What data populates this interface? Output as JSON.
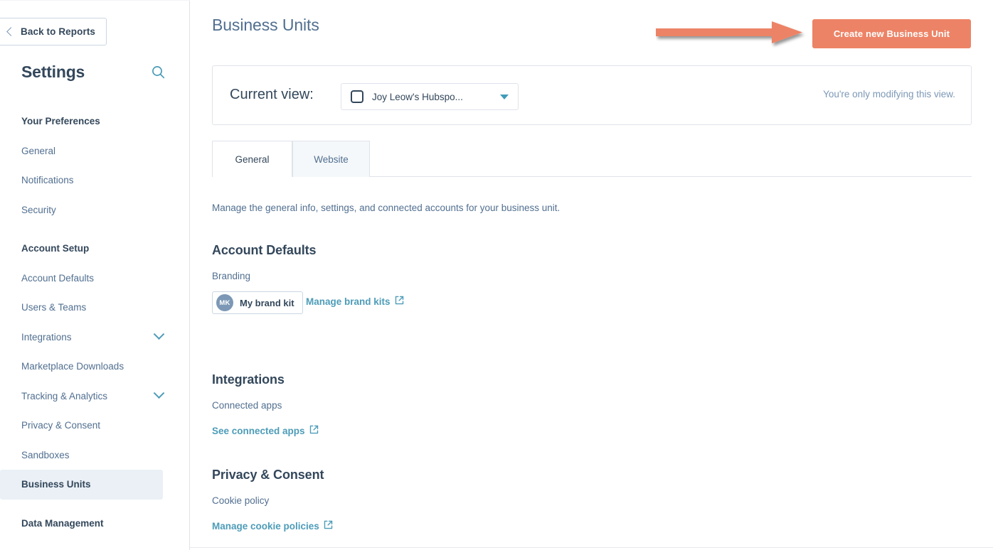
{
  "sidebar": {
    "back_button": {
      "label": "Back to Reports",
      "icon": "chevron-left-icon"
    },
    "title": "Settings",
    "search_icon": "search-icon",
    "items": [
      {
        "label": "Your Preferences",
        "type": "group"
      },
      {
        "label": "General",
        "type": "link"
      },
      {
        "label": "Notifications",
        "type": "link"
      },
      {
        "label": "Security",
        "type": "link"
      },
      {
        "label": "Account Setup",
        "type": "group"
      },
      {
        "label": "Account Defaults",
        "type": "link"
      },
      {
        "label": "Users & Teams",
        "type": "link"
      },
      {
        "label": "Integrations",
        "type": "link",
        "caret": "chevron-down-icon"
      },
      {
        "label": "Marketplace Downloads",
        "type": "link"
      },
      {
        "label": "Tracking & Analytics",
        "type": "link",
        "caret": "chevron-down-icon"
      },
      {
        "label": "Privacy & Consent",
        "type": "link"
      },
      {
        "label": "Sandboxes",
        "type": "link"
      },
      {
        "label": "Business Units",
        "type": "link",
        "active": true
      },
      {
        "label": "Data Management",
        "type": "group"
      }
    ]
  },
  "header": {
    "title": "Business Units",
    "create_button": "Create new Business Unit",
    "annotation_arrow": "arrow-right-annotation"
  },
  "current_view": {
    "label": "Current view:",
    "selected": "Joy Leow's Hubspo...",
    "unit_icon": "business-unit-square-icon",
    "caret_icon": "chevron-down-icon",
    "note": "You're only modifying this view."
  },
  "tabs": [
    {
      "label": "General",
      "active": true
    },
    {
      "label": "Website",
      "active": false
    }
  ],
  "intro": "Manage the general info, settings, and connected accounts for your business unit.",
  "sections": [
    {
      "heading": "Account Defaults",
      "sub": "Branding",
      "chip": {
        "avatar_initials": "MK",
        "label": "My brand kit"
      },
      "link": "Manage brand kits",
      "link_icon": "external-link-icon"
    },
    {
      "heading": "Integrations",
      "sub": "Connected apps",
      "link": "See connected apps",
      "link_icon": "external-link-icon"
    },
    {
      "heading": "Privacy & Consent",
      "sub": "Cookie policy",
      "link": "Manage cookie policies",
      "link_icon": "external-link-icon"
    }
  ],
  "colors": {
    "accent_orange": "#ed8366",
    "link_teal": "#4d9cb8",
    "text_dark": "#33475b",
    "text_muted": "#516f90",
    "border": "#dfe3eb",
    "active_bg": "#eaf0f6",
    "avatar_bg": "#7c98b6"
  }
}
